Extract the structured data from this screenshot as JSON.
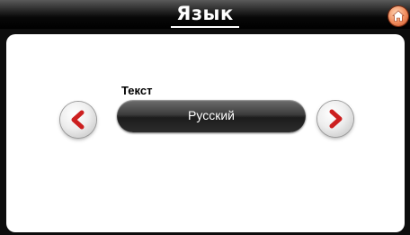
{
  "header": {
    "title": "Язык",
    "home_icon": "home-icon"
  },
  "setting": {
    "label": "Текст",
    "value": "Русский",
    "prev_icon": "chevron-left-icon",
    "next_icon": "chevron-right-icon"
  },
  "colors": {
    "accent_arrow": "#cc1f1f",
    "home_button": "#f08a5a",
    "panel_background": "#ffffff",
    "chrome_background": "#0d0d0d"
  }
}
